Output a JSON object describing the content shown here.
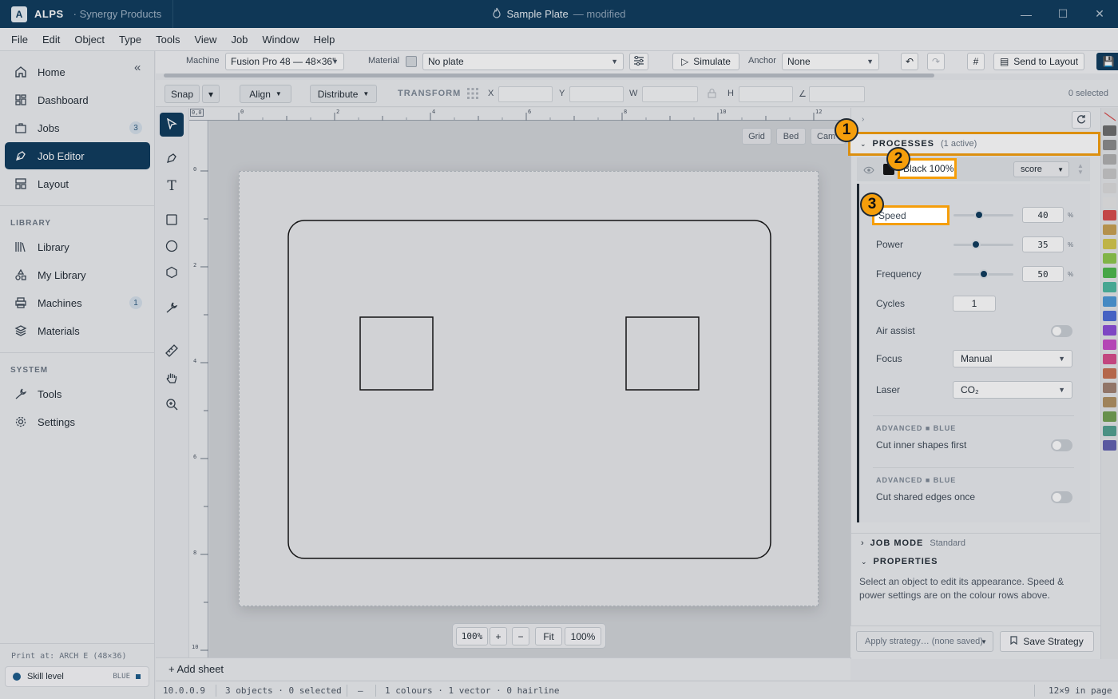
{
  "titlebar": {
    "app_initial": "A",
    "app_name": "ALPS",
    "org": "· Synergy Products",
    "doc_title": "Sample Plate",
    "doc_status": "— modified",
    "win_min": "—",
    "win_max": "☐",
    "win_close": "✕"
  },
  "menu": [
    "File",
    "Edit",
    "Object",
    "Type",
    "Tools",
    "View",
    "Job",
    "Window",
    "Help"
  ],
  "sidebar": {
    "collapse": "«",
    "nav_main": [
      {
        "label": "Home",
        "icon": "home-icon"
      },
      {
        "label": "Dashboard",
        "icon": "dashboard-icon"
      },
      {
        "label": "Jobs",
        "icon": "briefcase-icon",
        "badge": "3"
      },
      {
        "label": "Job Editor",
        "icon": "pen-tool-icon",
        "active": true
      },
      {
        "label": "Layout",
        "icon": "layout-icon"
      }
    ],
    "library_label": "LIBRARY",
    "nav_library": [
      {
        "label": "Library",
        "icon": "library-icon"
      },
      {
        "label": "My Library",
        "icon": "shapes-icon"
      },
      {
        "label": "Machines",
        "icon": "printer-icon",
        "badge": "1"
      },
      {
        "label": "Materials",
        "icon": "layers-icon"
      }
    ],
    "system_label": "SYSTEM",
    "nav_system": [
      {
        "label": "Tools",
        "icon": "wrench-icon"
      },
      {
        "label": "Settings",
        "icon": "gear-icon"
      }
    ],
    "print_at": "Print at: ARCH E (48×36)",
    "skill_label": "Skill level",
    "skill_value": "BLUE"
  },
  "toolbar1": {
    "machine_label": "Machine",
    "machine_value": "Fusion Pro 48 — 48×36\"",
    "material_label": "Material",
    "material_value": "No plate",
    "simulate": "Simulate",
    "anchor_label": "Anchor",
    "anchor_value": "None",
    "send_to_layout": "Send to Layout"
  },
  "toolbar2": {
    "snap": "Snap",
    "snap_dropdown": "▾",
    "align": "Align",
    "distribute": "Distribute",
    "transform": "TRANSFORM",
    "x": "X",
    "y": "Y",
    "w": "W",
    "h": "H",
    "selected": "0 selected"
  },
  "rulers": {
    "origin": "0,0",
    "top": [
      "0",
      "2",
      "4",
      "6",
      "8",
      "10",
      "12"
    ],
    "left": [
      "0",
      "2",
      "4",
      "6",
      "8",
      "10"
    ]
  },
  "canvas": {
    "chips": [
      "Grid",
      "Bed",
      "Cam"
    ],
    "zoom_value": "100%",
    "zoom_in": "+",
    "zoom_out": "−",
    "fit": "Fit",
    "zoom_100": "100%",
    "add_sheet": "+ Add sheet"
  },
  "panel": {
    "processes_title": "PROCESSES",
    "processes_sub": "(1 active)",
    "process_name": "Black 100%",
    "process_mode": "score",
    "speed_label": "Speed",
    "speed_value": "40",
    "power_label": "Power",
    "power_value": "35",
    "frequency_label": "Frequency",
    "frequency_value": "50",
    "pct": "%",
    "cycles_label": "Cycles",
    "cycles_value": "1",
    "air_label": "Air assist",
    "focus_label": "Focus",
    "focus_value": "Manual",
    "laser_label": "Laser",
    "laser_value": "CO₂",
    "adv1_label": "ADVANCED ■ BLUE",
    "adv1_item": "Cut inner shapes first",
    "adv2_label": "ADVANCED ■ BLUE",
    "adv2_item": "Cut shared edges once",
    "jobmode_title": "JOB MODE",
    "jobmode_sub": "Standard",
    "properties_title": "PROPERTIES",
    "properties_text": "Select an object to edit its appearance. Speed & power settings are on the colour rows above.",
    "strategy_placeholder": "Apply strategy… (none saved)",
    "save_strategy": "Save Strategy"
  },
  "callouts": [
    "1",
    "2",
    "3"
  ],
  "statusbar": {
    "ip": "10.0.0.9",
    "objects": "3 objects · 0 selected",
    "dash": "—",
    "colours": "1 colours · 1 vector · 0 hairline",
    "page": "12×9 in page"
  },
  "colors": {
    "accent": "#0c3a5c",
    "callout": "#f59e0b",
    "swatches": [
      "#6b6b6b",
      "#8a8a8a",
      "#b0b0b0",
      "#c8c8c8",
      "#dcdcdc",
      "#e8e8e8",
      "#d94a4a",
      "#c8a050",
      "#d4c84a",
      "#8cc84a",
      "#4ab84a",
      "#4ab8a0",
      "#4a98d8",
      "#4a6ad8",
      "#8a4ad8",
      "#c84ac8",
      "#d84a8a",
      "#c87050",
      "#a08070",
      "#b09060",
      "#70a050",
      "#50a090",
      "#6060b0"
    ]
  }
}
